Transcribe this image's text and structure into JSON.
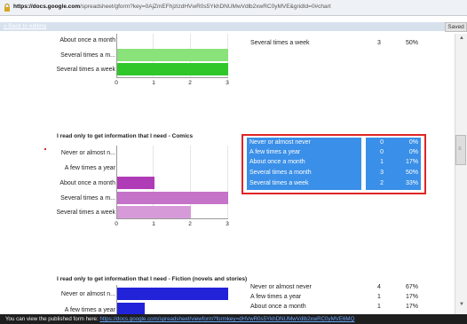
{
  "browser": {
    "url_host": "https://docs.google.com",
    "url_path": "/spreadsheet/gform?key=0AjZmEFhjzlzdHVwR0s5YkhDNUMwVdlb2xwRC0yMVE&gridId=0#chart"
  },
  "header": {
    "back_link": "« Back to editing",
    "saved_label": "Saved"
  },
  "section1": {
    "labels": [
      "About once a month",
      "Several times a m...",
      "Several times a week"
    ],
    "table": [
      {
        "label": "Several times a week",
        "count": "3",
        "pct": "50%"
      }
    ],
    "ticks": [
      "0",
      "1",
      "2",
      "3"
    ]
  },
  "section2": {
    "title": "I read only to get information that I need - Comics",
    "labels": [
      "Never or almost n...",
      "A few times a year",
      "About once a month",
      "Several times a m...",
      "Several times a week"
    ],
    "ticks": [
      "0",
      "1",
      "2",
      "3"
    ],
    "table": [
      {
        "label": "Never or almost never",
        "count": "0",
        "pct": "0%"
      },
      {
        "label": "A few times a year",
        "count": "0",
        "pct": "0%"
      },
      {
        "label": "About once a month",
        "count": "1",
        "pct": "17%"
      },
      {
        "label": "Several times a month",
        "count": "3",
        "pct": "50%"
      },
      {
        "label": "Several times a week",
        "count": "2",
        "pct": "33%"
      }
    ]
  },
  "section3": {
    "title": "I read only to get information that I need - Fiction (novels and stories)",
    "labels": [
      "Never or almost n...",
      "A few times a year"
    ],
    "table": [
      {
        "label": "Never or almost never",
        "count": "4",
        "pct": "67%"
      },
      {
        "label": "A few times a year",
        "count": "1",
        "pct": "17%"
      },
      {
        "label": "About once a month",
        "count": "1",
        "pct": "17%"
      }
    ]
  },
  "chart_data": [
    {
      "type": "bar",
      "orientation": "horizontal",
      "categories": [
        "About once a month",
        "Several times a m...",
        "Several times a week"
      ],
      "values": [
        null,
        3,
        3
      ],
      "xlim": [
        0,
        3
      ],
      "color": "#8ae27a"
    },
    {
      "type": "bar",
      "orientation": "horizontal",
      "title": "I read only to get information that I need - Comics",
      "categories": [
        "Never or almost n...",
        "A few times a year",
        "About once a month",
        "Several times a m...",
        "Several times a week"
      ],
      "values": [
        0,
        0,
        1,
        3,
        2
      ],
      "xlim": [
        0,
        3
      ],
      "colors": [
        "#b03bb6",
        "#b03bb6",
        "#b03bb6",
        "#c572c9",
        "#d79ad9"
      ]
    },
    {
      "type": "bar",
      "orientation": "horizontal",
      "title": "I read only to get information that I need - Fiction (novels and stories)",
      "categories": [
        "Never or almost n...",
        "A few times a year"
      ],
      "values": [
        4,
        1
      ],
      "color": "#2222d8"
    }
  ],
  "footer": {
    "text": "You can view the published form here:",
    "link": "https://docs.google.com/spreadsheet/viewform?formkey=dHVwR0s5YkhDNUMwVdlb2xwRC0yMVE6MQ"
  }
}
